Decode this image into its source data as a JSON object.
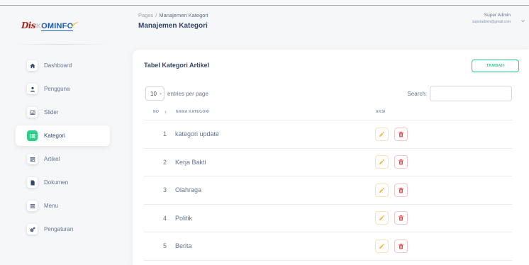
{
  "logo": {
    "part1": "Dis",
    "part2": "K",
    "part3": "OMINFO"
  },
  "breadcrumb": {
    "root": "Pages",
    "separator": "/",
    "current": "Manajemen Kategori"
  },
  "page_title": "Manajemen Kategori",
  "user": {
    "name": "Super Admin",
    "email": "superadmin@gmail.com",
    "menu_icon": "chevron-down-icon"
  },
  "sidebar": {
    "items": [
      {
        "label": "Dashboard",
        "icon": "home-icon",
        "active": false
      },
      {
        "label": "Pengguna",
        "icon": "user-icon",
        "active": false
      },
      {
        "label": "Slider",
        "icon": "image-icon",
        "active": false
      },
      {
        "label": "Kategori",
        "icon": "list-icon",
        "active": true
      },
      {
        "label": "Artikel",
        "icon": "newspaper-icon",
        "active": false
      },
      {
        "label": "Dokumen",
        "icon": "file-icon",
        "active": false
      },
      {
        "label": "Menu",
        "icon": "menu-icon",
        "active": false
      },
      {
        "label": "Pengaturan",
        "icon": "gear-icon",
        "active": false
      }
    ]
  },
  "card": {
    "title": "Tabel Kategori Artikel",
    "add_button_label": "TAMBAH",
    "entries": {
      "selected": "10",
      "suffix": "entries per page"
    },
    "search": {
      "label": "Search:"
    },
    "table": {
      "columns": [
        {
          "label": "NO",
          "sort_icon": "sort-asc-icon"
        },
        {
          "label": "NAMA KATEGORI"
        },
        {
          "label": "AKSI"
        }
      ],
      "row_actions": {
        "edit_icon": "pencil-icon",
        "delete_icon": "trash-icon"
      },
      "rows": [
        {
          "no": "1",
          "name": "kategori update"
        },
        {
          "no": "2",
          "name": "Kerja Bakti"
        },
        {
          "no": "3",
          "name": "Olahraga"
        },
        {
          "no": "4",
          "name": "Politik"
        },
        {
          "no": "5",
          "name": "Berita"
        }
      ]
    }
  },
  "colors": {
    "accent": "#2dce89",
    "edit": "#f5b642",
    "delete": "#e5484d",
    "text": "#344767",
    "muted": "#67748e"
  }
}
